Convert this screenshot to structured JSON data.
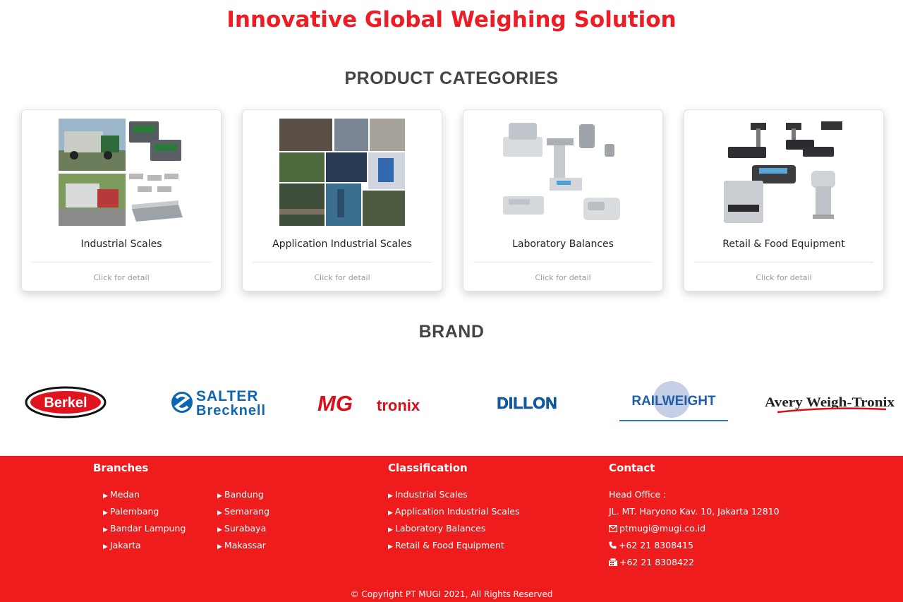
{
  "hero": {
    "title": "Innovative Global Weighing Solution"
  },
  "categories": {
    "heading": "PRODUCT CATEGORIES",
    "items": [
      {
        "name": "Industrial Scales",
        "detail": "Click for detail"
      },
      {
        "name": "Application Industrial Scales",
        "detail": "Click for detail"
      },
      {
        "name": "Laboratory Balances",
        "detail": "Click for detail"
      },
      {
        "name": "Retail & Food Equipment",
        "detail": "Click for detail"
      }
    ]
  },
  "brand": {
    "heading": "BRAND",
    "logos": {
      "berkel": "Berkel",
      "salter_1": "SALTER",
      "salter_2": "Brecknell",
      "mg_1": "MG",
      "mg_2": "tronix",
      "dillon": "DILLON",
      "railweight": "RAILWEIGHT",
      "avery": "Avery Weigh-Tronix"
    }
  },
  "footer": {
    "branches": {
      "heading": "Branches",
      "col1": [
        "Medan",
        "Palembang",
        "Bandar Lampung",
        "Jakarta"
      ],
      "col2": [
        "Bandung",
        "Semarang",
        "Surabaya",
        "Makassar"
      ]
    },
    "classification": {
      "heading": "Classification",
      "items": [
        "Industrial Scales",
        "Application Industrial Scales",
        "Laboratory Balances",
        "Retail & Food Equipment"
      ]
    },
    "contact": {
      "heading": "Contact",
      "head_office_label": "Head Office :",
      "address": "JL. MT. Haryono Kav. 10, Jakarta 12810",
      "email": "ptmugi@mugi.co.id",
      "phone": "+62 21 8308415",
      "fax": "+62 21 8308422"
    },
    "copyright": "© Copyright PT MUGI 2021, All Rights Reserved"
  },
  "colors": {
    "accent": "#ee1c25",
    "footer_bg": "#ee1c1c",
    "brand_blue": "#0d66b3"
  }
}
